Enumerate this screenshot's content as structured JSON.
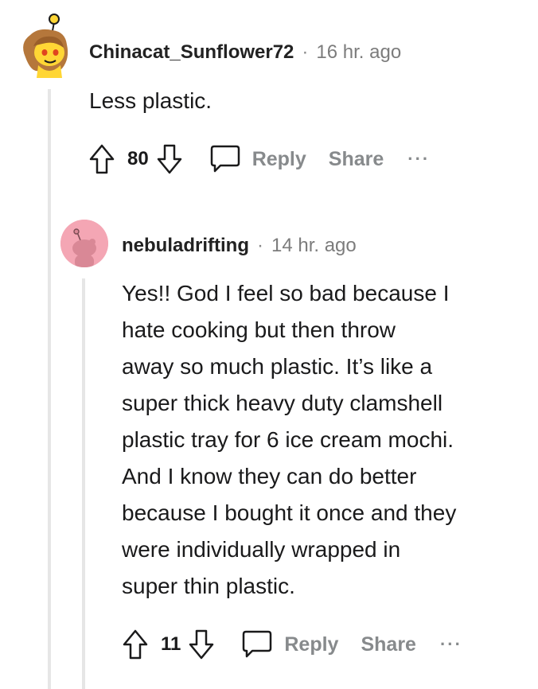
{
  "comment": {
    "username": "Chinacat_Sunflower72",
    "separator": "·",
    "time": "16 hr. ago",
    "text": "Less plastic.",
    "score": "80",
    "reply_label": "Reply",
    "share_label": "Share",
    "more_label": "···",
    "avatar_icon": "snoo-avatar-yellow"
  },
  "reply": {
    "username": "nebuladrifting",
    "separator": "·",
    "time": "14 hr. ago",
    "text_lines": [
      "Yes!! God I feel so bad because I",
      "hate cooking but then throw",
      "away so much plastic. It’s like a",
      "super thick heavy duty clamshell",
      "plastic tray for 6 ice cream mochi.",
      "And I know they can do better",
      "because I bought it once and they",
      "were individually wrapped in",
      "super thin plastic."
    ],
    "score": "11",
    "reply_label": "Reply",
    "share_label": "Share",
    "more_label": "···",
    "avatar_icon": "snoo-avatar-pink"
  },
  "colors": {
    "username": "#222222",
    "meta": "#7c7c7c",
    "action": "#878a8c",
    "thread_line": "#e6e6e6",
    "avatar_pink": "#f4a6b4",
    "avatar_yellow": "#ffd635"
  }
}
